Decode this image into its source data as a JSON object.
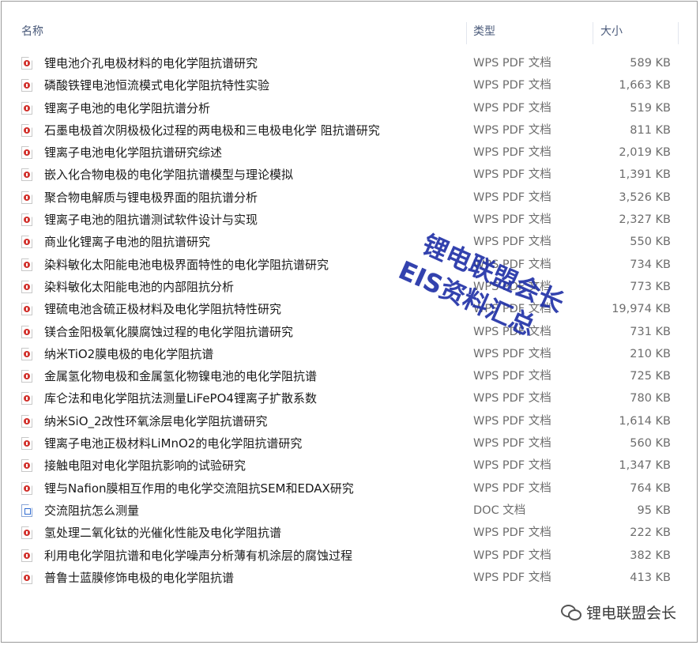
{
  "columns": {
    "name": "名称",
    "type": "类型",
    "size": "大小"
  },
  "files": [
    {
      "name": "锂电池介孔电极材料的电化学阻抗谱研究",
      "type": "WPS PDF 文档",
      "size": "589 KB",
      "icon": "pdf-icon"
    },
    {
      "name": "磷酸铁锂电池恒流模式电化学阻抗特性实验",
      "type": "WPS PDF 文档",
      "size": "1,663 KB",
      "icon": "pdf-icon"
    },
    {
      "name": "锂离子电池的电化学阻抗谱分析",
      "type": "WPS PDF 文档",
      "size": "519 KB",
      "icon": "pdf-icon"
    },
    {
      "name": "石墨电极首次阴极极化过程的两电极和三电极电化学 阻抗谱研究",
      "type": "WPS PDF 文档",
      "size": "811 KB",
      "icon": "pdf-icon"
    },
    {
      "name": "锂离子电池电化学阻抗谱研究综述",
      "type": "WPS PDF 文档",
      "size": "2,019 KB",
      "icon": "pdf-icon"
    },
    {
      "name": "嵌入化合物电极的电化学阻抗谱模型与理论模拟",
      "type": "WPS PDF 文档",
      "size": "1,391 KB",
      "icon": "pdf-icon"
    },
    {
      "name": "聚合物电解质与锂电极界面的阻抗谱分析",
      "type": "WPS PDF 文档",
      "size": "3,526 KB",
      "icon": "pdf-icon"
    },
    {
      "name": "锂离子电池的阻抗谱测试软件设计与实现",
      "type": "WPS PDF 文档",
      "size": "2,327 KB",
      "icon": "pdf-icon"
    },
    {
      "name": "商业化锂离子电池的阻抗谱研究",
      "type": "WPS PDF 文档",
      "size": "550 KB",
      "icon": "pdf-icon"
    },
    {
      "name": "染料敏化太阳能电池电极界面特性的电化学阻抗谱研究",
      "type": "WPS PDF 文档",
      "size": "734 KB",
      "icon": "pdf-icon"
    },
    {
      "name": "染料敏化太阳能电池的内部阻抗分析",
      "type": "WPS PDF 文档",
      "size": "773 KB",
      "icon": "pdf-icon"
    },
    {
      "name": "锂硫电池含硫正极材料及电化学阻抗特性研究",
      "type": "WPS PDF 文档",
      "size": "19,974 KB",
      "icon": "pdf-icon"
    },
    {
      "name": "镁合金阳极氧化膜腐蚀过程的电化学阻抗谱研究",
      "type": "WPS PDF 文档",
      "size": "731 KB",
      "icon": "pdf-icon"
    },
    {
      "name": "纳米TiO2膜电极的电化学阻抗谱",
      "type": "WPS PDF 文档",
      "size": "210 KB",
      "icon": "pdf-icon"
    },
    {
      "name": "金属氢化物电极和金属氢化物镍电池的电化学阻抗谱",
      "type": "WPS PDF 文档",
      "size": "725 KB",
      "icon": "pdf-icon"
    },
    {
      "name": "库仑法和电化学阻抗法测量LiFePO4锂离子扩散系数",
      "type": "WPS PDF 文档",
      "size": "780 KB",
      "icon": "pdf-icon"
    },
    {
      "name": "纳米SiO_2改性环氧涂层电化学阻抗谱研究",
      "type": "WPS PDF 文档",
      "size": "1,614 KB",
      "icon": "pdf-icon"
    },
    {
      "name": "锂离子电池正极材料LiMnO2的电化学阻抗谱研究",
      "type": "WPS PDF 文档",
      "size": "560 KB",
      "icon": "pdf-icon"
    },
    {
      "name": "接触电阻对电化学阻抗影响的试验研究",
      "type": "WPS PDF 文档",
      "size": "1,347 KB",
      "icon": "pdf-icon"
    },
    {
      "name": "锂与Nafion膜相互作用的电化学交流阻抗SEM和EDAX研究",
      "type": "WPS PDF 文档",
      "size": "764 KB",
      "icon": "pdf-icon"
    },
    {
      "name": "交流阻抗怎么测量",
      "type": "DOC 文档",
      "size": "95 KB",
      "icon": "doc-icon"
    },
    {
      "name": "氢处理二氧化钛的光催化性能及电化学阻抗谱",
      "type": "WPS PDF 文档",
      "size": "222 KB",
      "icon": "pdf-icon"
    },
    {
      "name": "利用电化学阻抗谱和电化学噪声分析薄有机涂层的腐蚀过程",
      "type": "WPS PDF 文档",
      "size": "382 KB",
      "icon": "pdf-icon"
    },
    {
      "name": "普鲁士蓝膜修饰电极的电化学阻抗谱",
      "type": "WPS PDF 文档",
      "size": "413 KB",
      "icon": "pdf-icon"
    }
  ],
  "watermark": {
    "line1": "锂电联盟会长",
    "line2": "EIS资料汇总"
  },
  "footer": {
    "text": "锂电联盟会长",
    "icon": "wechat-icon"
  },
  "colors": {
    "watermark": "#2233a8",
    "pdf_icon": "#d2322d",
    "doc_icon": "#2f6bd1"
  }
}
